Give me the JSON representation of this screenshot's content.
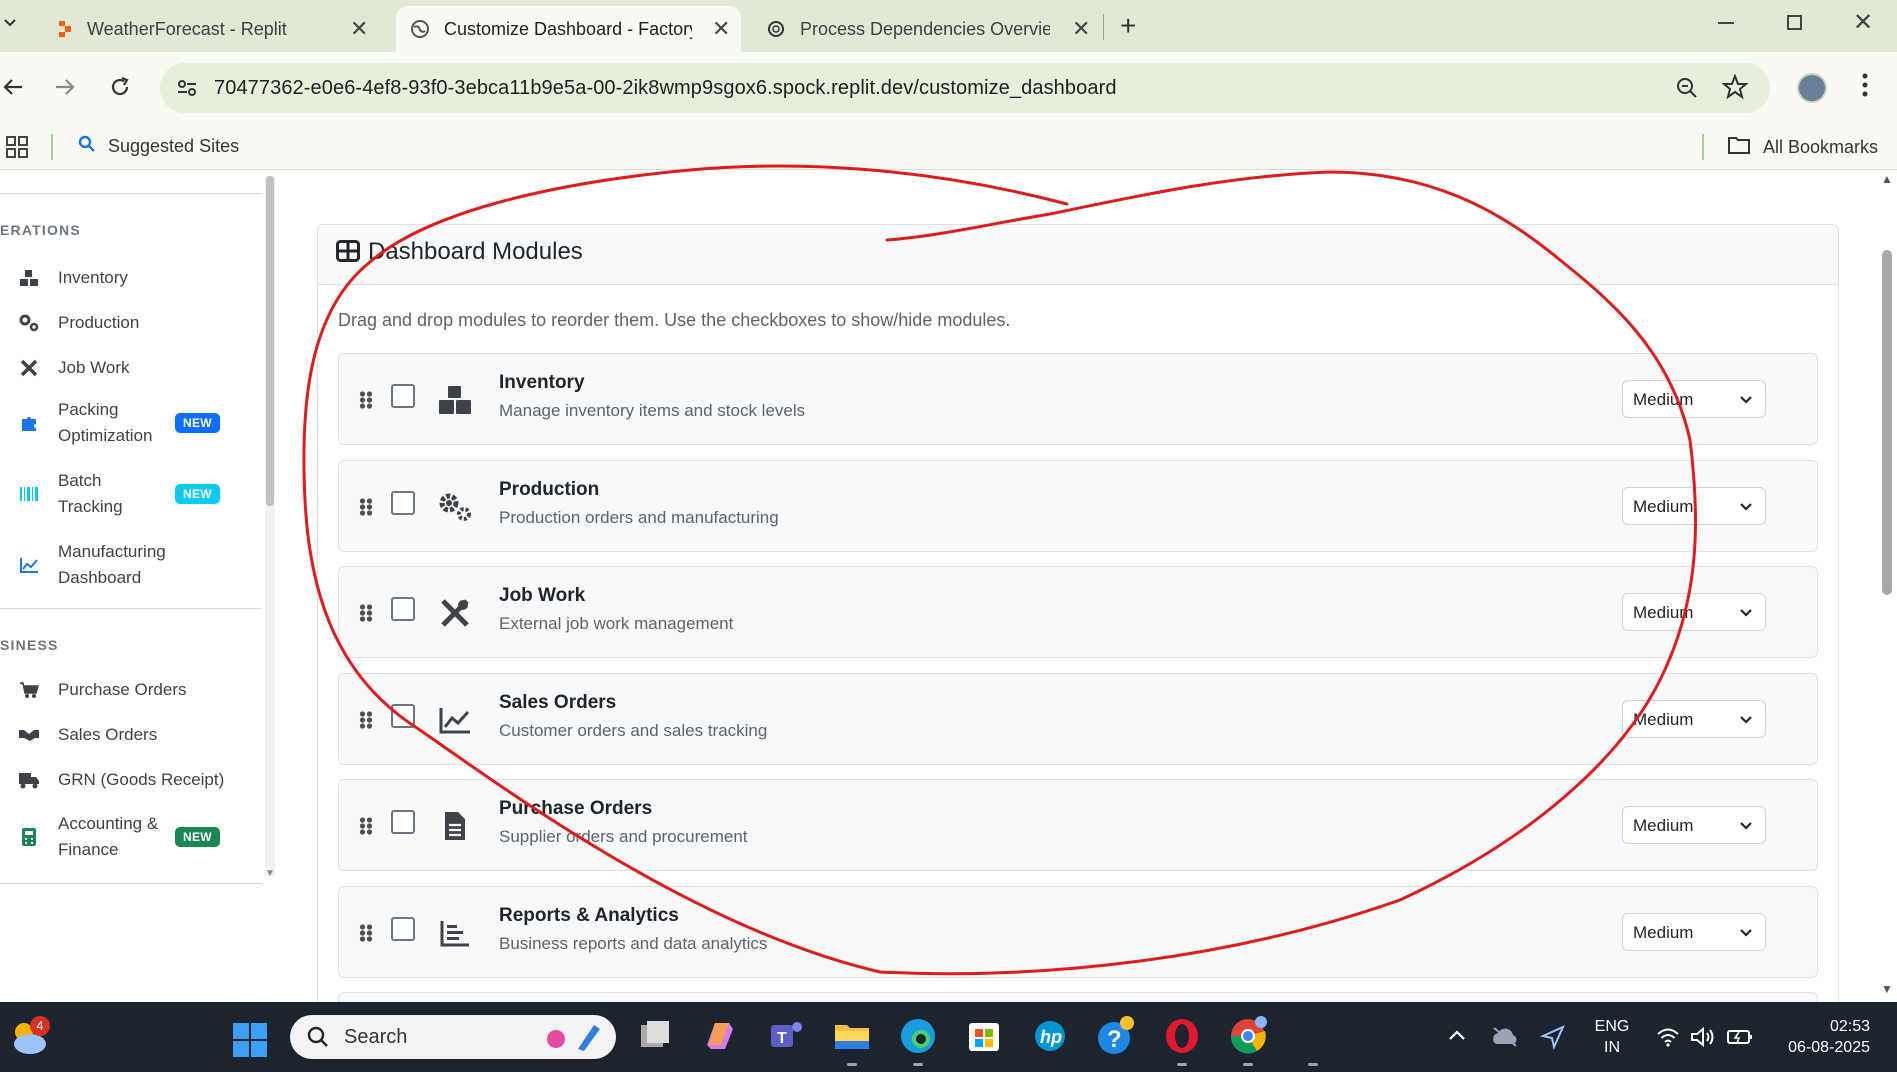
{
  "browser": {
    "tabs": [
      {
        "title": "WeatherForecast - Replit",
        "active": false
      },
      {
        "title": "Customize Dashboard - Factory",
        "active": true
      },
      {
        "title": "Process Dependencies Overview",
        "active": false
      }
    ],
    "url": "70477362-e0e6-4ef8-93f0-3ebca11b9e5a-00-2ik8wmp9sgox6.spock.replit.dev/customize_dashboard",
    "bookmarks": {
      "suggested": "Suggested Sites",
      "all": "All Bookmarks"
    }
  },
  "sidebar": {
    "sections": [
      {
        "heading": "ERATIONS",
        "items": [
          {
            "label": "Inventory",
            "icon": "boxes-icon"
          },
          {
            "label": "Production",
            "icon": "cogs-icon"
          },
          {
            "label": "Job Work",
            "icon": "tools-icon"
          },
          {
            "label": "Packing Optimization",
            "icon": "puzzle-icon",
            "badge": "NEW"
          },
          {
            "label": "Batch Tracking",
            "icon": "barcode-icon",
            "badge": "NEW"
          },
          {
            "label": "Manufacturing Dashboard",
            "icon": "chart-line-icon"
          }
        ]
      },
      {
        "heading": "SINESS",
        "items": [
          {
            "label": "Purchase Orders",
            "icon": "cart-icon"
          },
          {
            "label": "Sales Orders",
            "icon": "handshake-icon"
          },
          {
            "label": "GRN (Goods Receipt)",
            "icon": "truck-icon"
          },
          {
            "label": "Accounting & Finance",
            "icon": "calculator-icon",
            "badge": "NEW"
          }
        ]
      }
    ]
  },
  "main": {
    "card_title": "Dashboard Modules",
    "description": "Drag and drop modules to reorder them. Use the checkboxes to show/hide modules.",
    "modules": [
      {
        "name": "Inventory",
        "desc": "Manage inventory items and stock levels",
        "size": "Medium",
        "icon": "boxes-icon",
        "checked": false
      },
      {
        "name": "Production",
        "desc": "Production orders and manufacturing",
        "size": "Medium",
        "icon": "cogs-icon",
        "checked": false
      },
      {
        "name": "Job Work",
        "desc": "External job work management",
        "size": "Medium",
        "icon": "tools-icon",
        "checked": false
      },
      {
        "name": "Sales Orders",
        "desc": "Customer orders and sales tracking",
        "size": "Medium",
        "icon": "chart-line-icon",
        "checked": false
      },
      {
        "name": "Purchase Orders",
        "desc": "Supplier orders and procurement",
        "size": "Medium",
        "icon": "file-icon",
        "checked": false
      },
      {
        "name": "Reports & Analytics",
        "desc": "Business reports and data analytics",
        "size": "Medium",
        "icon": "chart-bar-icon",
        "checked": false
      }
    ]
  },
  "taskbar": {
    "search": "Search",
    "weather_badge": "4",
    "lang": "ENG",
    "region": "IN",
    "time": "02:53",
    "date": "06-08-2025"
  },
  "colors": {
    "badge_blue": "#0d6efd",
    "badge_cyan": "#0dcaf0",
    "badge_green": "#198754",
    "annotation_red": "#e01b1b",
    "chrome_green": "#dfe9d3"
  }
}
